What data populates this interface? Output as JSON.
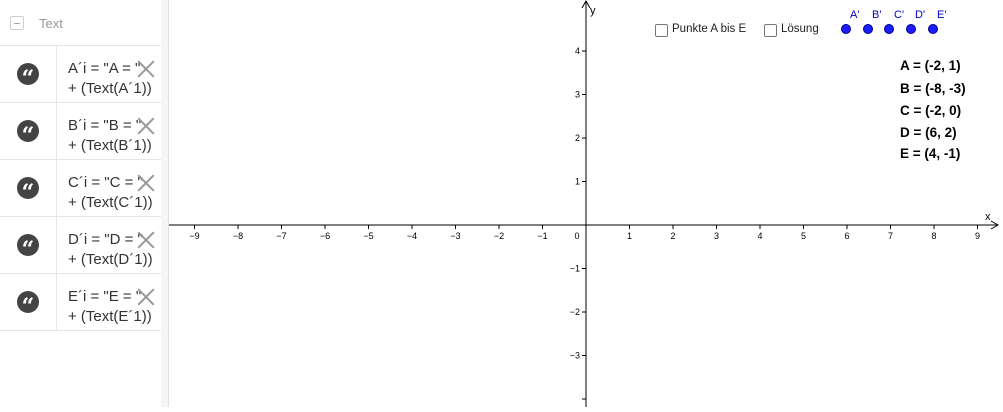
{
  "algebra_view": {
    "header_title": "Text",
    "rows": [
      {
        "line1": "A´i = \"A = \"",
        "line2": "+ (Text(A´1))"
      },
      {
        "line1": "B´i = \"B = \"",
        "line2": "+ (Text(B´1))"
      },
      {
        "line1": "C´i = \"C = \"",
        "line2": "+ (Text(C´1))"
      },
      {
        "line1": "D´i = \"D = \"",
        "line2": "+ (Text(D´1))"
      },
      {
        "line1": "E´i = \"E = \"",
        "line2": "+ (Text(E´1))"
      }
    ]
  },
  "graphics_view": {
    "axis_labels": {
      "x": "x",
      "y": "y"
    },
    "x_ticks": [
      "−9",
      "−8",
      "−7",
      "−6",
      "−5",
      "−4",
      "−3",
      "−2",
      "−1",
      "0",
      "1",
      "2",
      "3",
      "4",
      "5",
      "6",
      "7",
      "8",
      "9"
    ],
    "y_ticks": [
      "4",
      "3",
      "2",
      "1",
      "−1",
      "−2",
      "−3"
    ],
    "checkboxes": [
      {
        "label": "Punkte A bis E",
        "checked": false
      },
      {
        "label": "Lösung",
        "checked": false
      }
    ],
    "points": [
      {
        "label": "A'",
        "x": 6,
        "y": 4.5
      },
      {
        "label": "B'",
        "x": 6.5,
        "y": 4.5
      },
      {
        "label": "C'",
        "x": 7,
        "y": 4.5
      },
      {
        "label": "D'",
        "x": 7.5,
        "y": 4.5
      },
      {
        "label": "E'",
        "x": 8,
        "y": 4.5
      }
    ],
    "point_color": "#1c1cff",
    "coordinates": [
      "A = (-2, 1)",
      "B = (-8, -3)",
      "C = (-2, 0)",
      "D = (6, 2)",
      "E = (4, -1)"
    ]
  }
}
